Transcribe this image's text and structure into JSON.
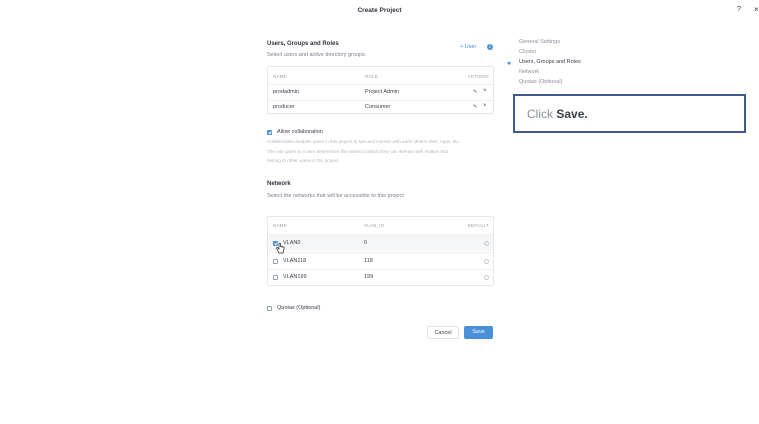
{
  "dialog": {
    "title": "Create Project",
    "help": "?",
    "close": "×"
  },
  "users": {
    "title": "Users, Groups and Roles",
    "subtitle": "Select users and active directory groups.",
    "add_label": "+ User",
    "info": "i",
    "columns": [
      "NAME",
      "ROLE",
      "ACTIONS"
    ],
    "rows": [
      {
        "name": "prodadmin",
        "role": "Project Admin"
      },
      {
        "name": "producer",
        "role": "Consumer"
      }
    ],
    "edit_icon": "✎",
    "delete_icon": "×"
  },
  "collaboration": {
    "label": "Allow collaboration",
    "checked": true,
    "line1": "Collaboration enables users in this project to see and interact with each other's VMs, Apps, etc.",
    "line2": "The role given to a user determines the extent to which they can interact with entities that",
    "line3": "belong to other users in this project"
  },
  "network": {
    "title": "Network",
    "subtitle": "Select the networks that will be accessible to this project",
    "columns": [
      "NAME",
      "VLAN_ID",
      "DEFAULT"
    ],
    "rows": [
      {
        "name": "VLAN0",
        "vlan_id": "0",
        "checked": true
      },
      {
        "name": "VLAN118",
        "vlan_id": "118",
        "checked": false
      },
      {
        "name": "VLAN199",
        "vlan_id": "199",
        "checked": false
      }
    ]
  },
  "quotas": {
    "label": "Quotas (Optional)",
    "checked": false
  },
  "buttons": {
    "cancel": "Cancel",
    "save": "Save"
  },
  "nav": {
    "items": [
      "General Settings",
      "Cluster",
      "Users, Groups and Roles",
      "Network",
      "Quotas (Optional)"
    ],
    "active_index": 2
  },
  "callout": {
    "prefix": "Click ",
    "emphasis": "Save."
  },
  "colors": {
    "accent": "#4a90d9",
    "callout_border": "#3f5b8c"
  }
}
